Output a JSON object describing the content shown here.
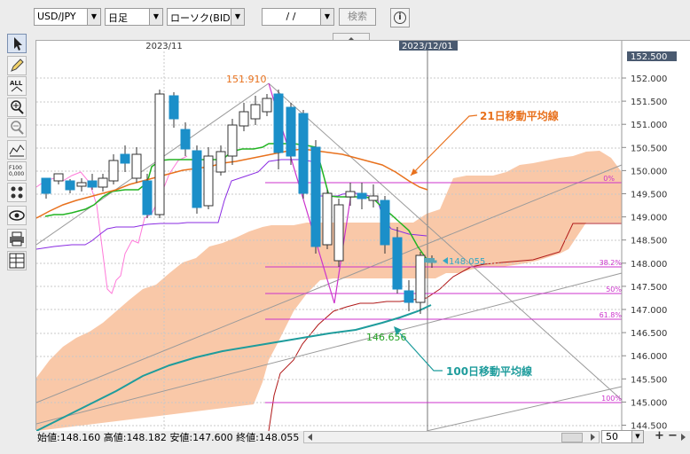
{
  "toolbar": {
    "symbol": "USD/JPY",
    "period": "日足",
    "chart_type": "ローソク(BID)",
    "date_value": "/ /",
    "search_label": "検索"
  },
  "chart": {
    "month_labels": [
      "2023/11",
      "2023/12/01"
    ],
    "price_axis": [
      "152.000",
      "151.500",
      "151.000",
      "150.500",
      "150.000",
      "149.500",
      "149.000",
      "148.500",
      "148.000",
      "147.500",
      "147.000",
      "146.500",
      "146.000",
      "145.500",
      "145.000",
      "144.500"
    ],
    "price_axis_top": "152.500",
    "current_price": "148.055",
    "high_label": "151.910",
    "ma100_value": "146.656",
    "annotation_21": "21日移動平均線",
    "annotation_100": "100日移動平均線",
    "fib_labels": [
      "0%",
      "38.2%",
      "50%",
      "61.8%",
      "100%"
    ],
    "colors": {
      "bull": "#1b8fc9",
      "cloud": "#f9c8a8",
      "ma21": "#e8711d",
      "ma100": "#1e9c9c",
      "line_green": "#22b422",
      "line_purple": "#8a2be2",
      "line_pink": "#ff7ad9",
      "fib": "#cc33cc",
      "annotation_orange": "#e8711d",
      "annotation_teal": "#1e9c9c"
    }
  },
  "status": {
    "open_label": "始値:",
    "open": "148.160",
    "high_label": "高値:",
    "high": "148.182",
    "low_label": "安値:",
    "low": "147.600",
    "close_label": "終値:",
    "close": "148.055",
    "zoom": "50"
  }
}
